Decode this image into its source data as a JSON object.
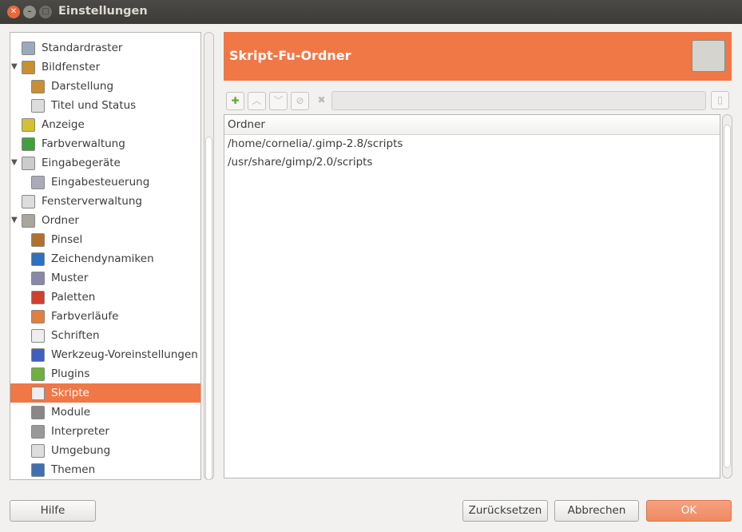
{
  "window": {
    "title": "Einstellungen"
  },
  "tree": [
    {
      "label": "Standardraster",
      "level": 1,
      "icon": "grid-icon",
      "color": "#9ab"
    },
    {
      "label": "Bildfenster",
      "level": 1,
      "expander": true,
      "icon": "image-window-icon",
      "color": "#c89030"
    },
    {
      "label": "Darstellung",
      "level": 2,
      "icon": "appearance-icon",
      "color": "#c89030"
    },
    {
      "label": "Titel und Status",
      "level": 2,
      "icon": "title-status-icon",
      "color": "#ddd"
    },
    {
      "label": "Anzeige",
      "level": 1,
      "icon": "display-icon",
      "color": "#d4c030"
    },
    {
      "label": "Farbverwaltung",
      "level": 1,
      "icon": "color-management-icon",
      "color": "#40a040"
    },
    {
      "label": "Eingabegeräte",
      "level": 1,
      "expander": true,
      "icon": "input-devices-icon",
      "color": "#ccc"
    },
    {
      "label": "Eingabesteuerung",
      "level": 2,
      "icon": "input-controllers-icon",
      "color": "#aab"
    },
    {
      "label": "Fensterverwaltung",
      "level": 1,
      "icon": "window-management-icon",
      "color": "#ddd"
    },
    {
      "label": "Ordner",
      "level": 1,
      "expander": true,
      "icon": "folder-icon",
      "color": "#a9a69d"
    },
    {
      "label": "Pinsel",
      "level": 2,
      "icon": "brush-icon",
      "color": "#b07030"
    },
    {
      "label": "Zeichendynamiken",
      "level": 2,
      "icon": "paint-dynamics-icon",
      "color": "#3070c0"
    },
    {
      "label": "Muster",
      "level": 2,
      "icon": "pattern-icon",
      "color": "#88a"
    },
    {
      "label": "Paletten",
      "level": 2,
      "icon": "palette-icon",
      "color": "#d04030"
    },
    {
      "label": "Farbverläufe",
      "level": 2,
      "icon": "gradient-icon",
      "color": "#e08040"
    },
    {
      "label": "Schriften",
      "level": 2,
      "icon": "fonts-icon",
      "color": "#eee"
    },
    {
      "label": "Werkzeug-Voreinstellungen",
      "level": 2,
      "icon": "tool-presets-icon",
      "color": "#4060c0"
    },
    {
      "label": "Plugins",
      "level": 2,
      "icon": "plugin-icon",
      "color": "#70b040"
    },
    {
      "label": "Skripte",
      "level": 2,
      "icon": "scripts-icon",
      "color": "#eee",
      "selected": true
    },
    {
      "label": "Module",
      "level": 2,
      "icon": "modules-icon",
      "color": "#888"
    },
    {
      "label": "Interpreter",
      "level": 2,
      "icon": "interpreter-icon",
      "color": "#999"
    },
    {
      "label": "Umgebung",
      "level": 2,
      "icon": "environment-icon",
      "color": "#ddd"
    },
    {
      "label": "Themen",
      "level": 2,
      "icon": "themes-icon",
      "color": "#4070b0"
    }
  ],
  "panel": {
    "title": "Skript-Fu-Ordner",
    "column_header": "Ordner",
    "folders": [
      "/home/cornelia/.gimp-2.8/scripts",
      "/usr/share/gimp/2.0/scripts"
    ],
    "path_value": ""
  },
  "buttons": {
    "help": "Hilfe",
    "reset": "Zurücksetzen",
    "cancel": "Abbrechen",
    "ok": "OK"
  },
  "accent": "#f07746"
}
